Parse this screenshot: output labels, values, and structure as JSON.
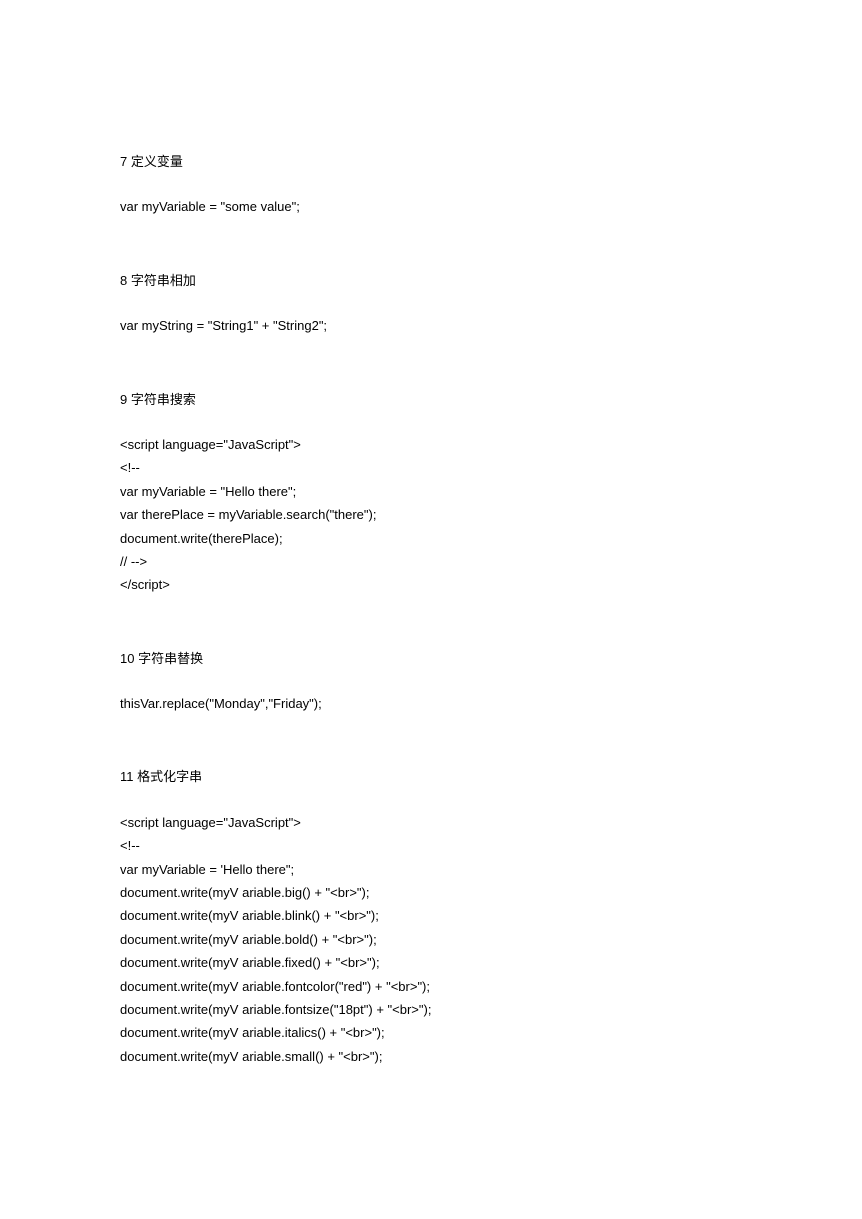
{
  "sections": [
    {
      "heading": "7  定义变量",
      "lines": [
        "var myVariable = \"some value\";"
      ]
    },
    {
      "heading": "8  字符串相加",
      "lines": [
        "var myString = \"String1\" + \"String2\";"
      ]
    },
    {
      "heading": "9  字符串搜索",
      "lines": [
        "<script language=\"JavaScript\">",
        "<!--",
        "var myVariable = \"Hello there\";",
        "var therePlace = myVariable.search(\"there\");",
        "document.write(therePlace);",
        "// -->",
        "</script>"
      ]
    },
    {
      "heading": "10  字符串替换",
      "lines": [
        "thisVar.replace(\"Monday\",\"Friday\");"
      ]
    },
    {
      "heading": "11  格式化字串",
      "lines": [
        "<script language=\"JavaScript\">",
        "<!--",
        "var myVariable = 'Hello there\";",
        "document.write(myV ariable.big() + \"<br>\");",
        "document.write(myV ariable.blink() + \"<br>\");",
        "document.write(myV ariable.bold() + \"<br>\");",
        "document.write(myV ariable.fixed() + \"<br>\");",
        "document.write(myV ariable.fontcolor(\"red\") + \"<br>\");",
        "document.write(myV ariable.fontsize(\"18pt\") + \"<br>\");",
        "document.write(myV ariable.italics() + \"<br>\");",
        "document.write(myV ariable.small() + \"<br>\");"
      ]
    }
  ]
}
